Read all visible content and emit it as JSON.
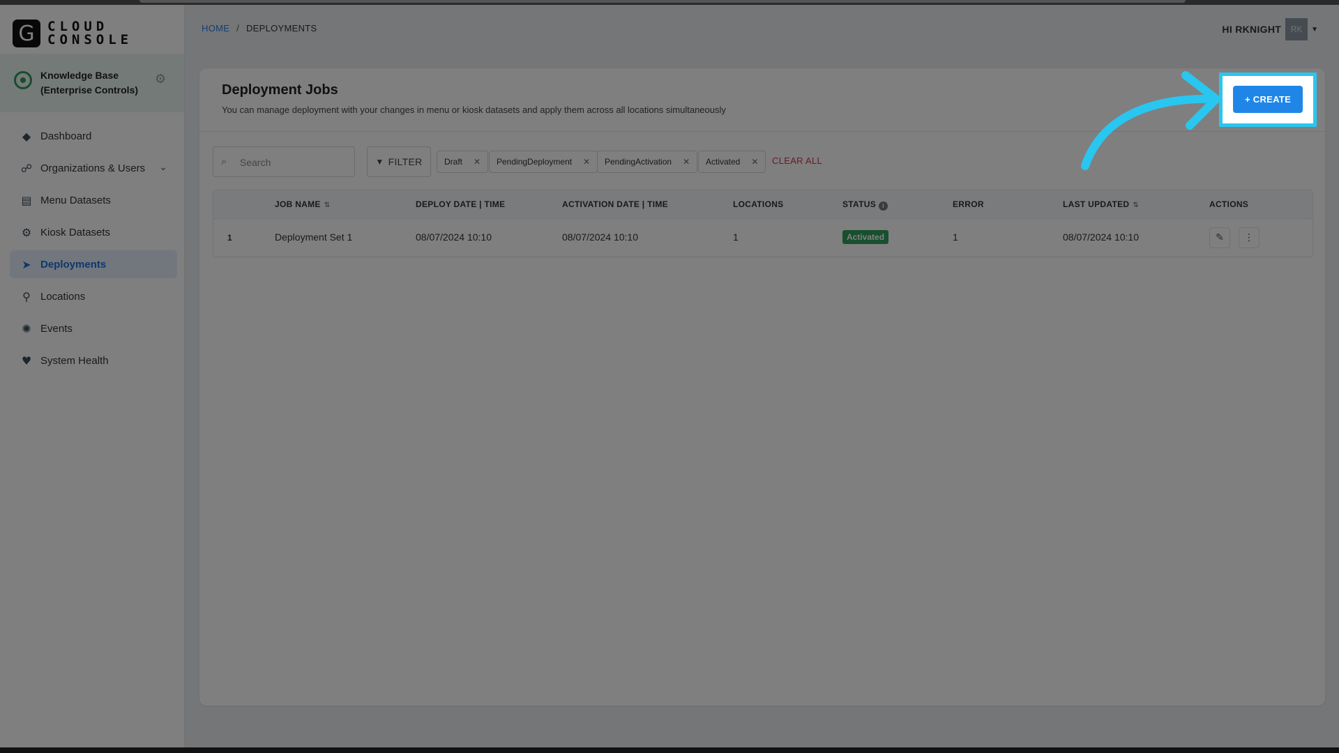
{
  "brand": {
    "mark": "G",
    "line1": "CLOUD",
    "line2": "CONSOLE"
  },
  "org": {
    "name": "Knowledge Base (Enterprise Controls)"
  },
  "sidebar": {
    "items": [
      {
        "label": "Dashboard",
        "icon": "layers-icon",
        "glyph": "◆"
      },
      {
        "label": "Organizations & Users",
        "icon": "org-chart-icon",
        "glyph": "☍",
        "chevron": "⌄"
      },
      {
        "label": "Menu Datasets",
        "icon": "menu-dataset-icon",
        "glyph": "▤"
      },
      {
        "label": "Kiosk Datasets",
        "icon": "kiosk-gear-icon",
        "glyph": "⚙"
      },
      {
        "label": "Deployments",
        "icon": "paper-plane-icon",
        "glyph": "➤"
      },
      {
        "label": "Locations",
        "icon": "map-pin-icon",
        "glyph": "⚲"
      },
      {
        "label": "Events",
        "icon": "events-icon",
        "glyph": "✺"
      },
      {
        "label": "System Health",
        "icon": "heart-pulse-icon",
        "glyph": "♥"
      }
    ]
  },
  "breadcrumb": {
    "home": "HOME",
    "sep": "/",
    "current": "DEPLOYMENTS"
  },
  "user": {
    "greeting": "HI RKNIGHT",
    "initials": "RK"
  },
  "page": {
    "title": "Deployment Jobs",
    "subtitle": "You can manage deployment with your changes in menu or kiosk datasets and apply them across all locations simultaneously",
    "create_label": "+ CREATE"
  },
  "toolbar": {
    "search_placeholder": "Search",
    "filter_label": "FILTER",
    "chips": [
      "Draft",
      "PendingDeployment",
      "PendingActivation",
      "Activated"
    ],
    "clear_all": "CLEAR ALL"
  },
  "table": {
    "headers": {
      "job_name": "JOB NAME",
      "deploy_date": "DEPLOY DATE | TIME",
      "activation_date": "ACTIVATION DATE | TIME",
      "locations": "LOCATIONS",
      "status": "STATUS",
      "error": "ERROR",
      "last_updated": "LAST UPDATED",
      "actions": "ACTIONS"
    },
    "rows": [
      {
        "index": "1",
        "job_name": "Deployment Set 1",
        "deploy_date": "08/07/2024 10:10",
        "activation_date": "08/07/2024 10:10",
        "locations": "1",
        "status": "Activated",
        "error": "1",
        "last_updated": "08/07/2024 10:10"
      }
    ]
  },
  "colors": {
    "accent": "#1f86e8",
    "highlight": "#29c6f0",
    "status_activated": "#2f9e5f",
    "clear_all": "#d6334a"
  }
}
